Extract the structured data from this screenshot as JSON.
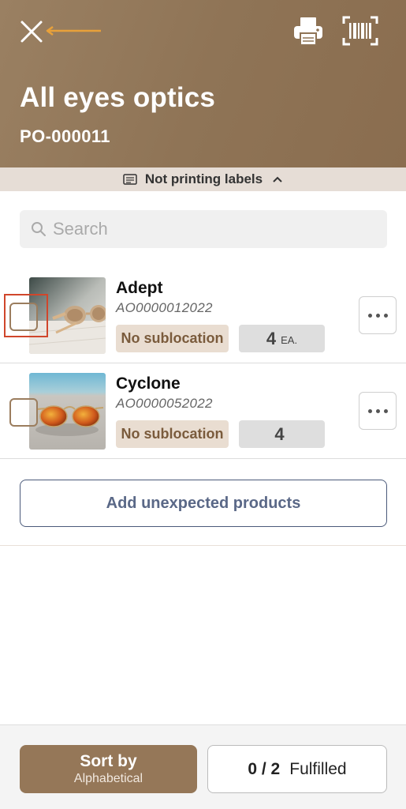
{
  "header": {
    "title": "All eyes optics",
    "po_number": "PO-000011"
  },
  "print_bar": {
    "label": "Not printing labels"
  },
  "search": {
    "placeholder": "Search"
  },
  "products": [
    {
      "name": "Adept",
      "sku": "AO0000012022",
      "sublocation": "No sublocation",
      "quantity": "4",
      "unit": "EA."
    },
    {
      "name": "Cyclone",
      "sku": "AO0000052022",
      "sublocation": "No sublocation",
      "quantity": "4",
      "unit": ""
    }
  ],
  "add_button": {
    "label": "Add unexpected products"
  },
  "footer": {
    "sort_title": "Sort by",
    "sort_value": "Alphabetical",
    "fulfilled_count": "0 / 2",
    "fulfilled_label": "Fulfilled"
  },
  "colors": {
    "brand_brown": "#957758",
    "annotation_orange": "#e8a13a",
    "highlight_red": "#d0462b",
    "accent_blue": "#5a6887"
  }
}
